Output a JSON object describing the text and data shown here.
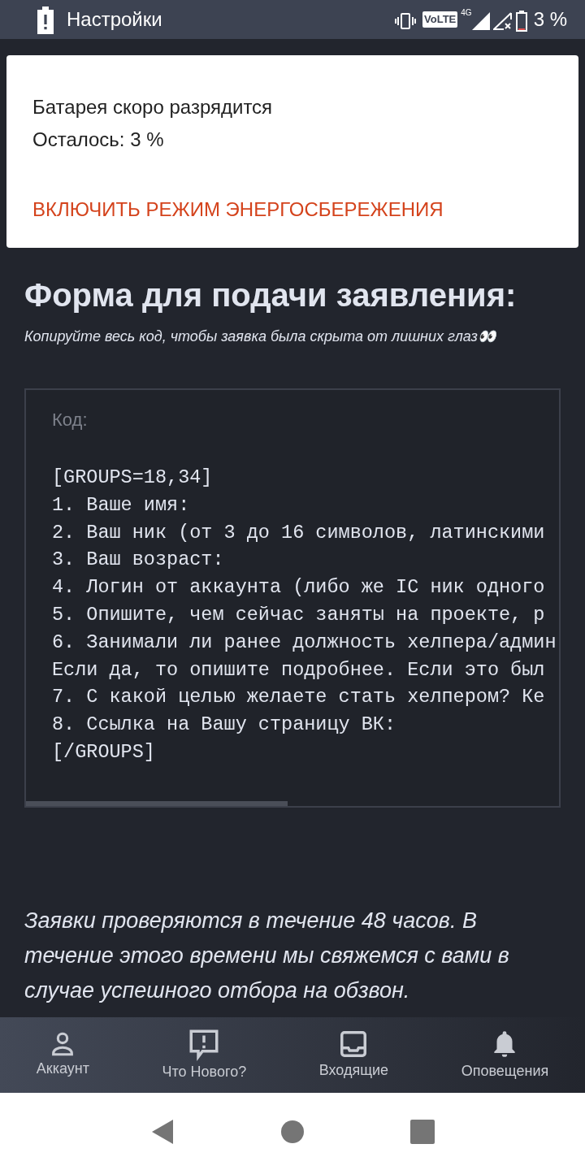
{
  "status_bar": {
    "app": "Настройки",
    "volte": "VoLTE",
    "network": "4G",
    "battery": "3 %"
  },
  "notification": {
    "title": "Батарея скоро разрядится",
    "text": "Осталось: 3 %",
    "action": "ВКЛЮЧИТЬ РЕЖИМ ЭНЕРГОСБЕРЕЖЕНИЯ"
  },
  "heading": "Форма для подачи заявления:",
  "subtitle": "Копируйте весь код, чтобы заявка была скрыта от лишних глаз👀",
  "code_block": {
    "label": "Код:",
    "lines": [
      "[GROUPS=18,34]",
      "1. Ваше имя:",
      "2. Ваш ник (от 3 до 16 символов, латинскими",
      "3. Ваш возраст:",
      "4. Логин от аккаунта (либо же IC ник одного",
      "5. Опишите, чем сейчас заняты на проекте, р",
      "6. Занимали ли ранее должность хелпера/админ",
      "Если да, то опишите подробнее. Если это был",
      "7. С какой целью желаете стать хелпером? Ке",
      "8. Ссылка на Вашу страницу ВК:",
      "[/GROUPS]"
    ]
  },
  "note": "Заявки проверяются в течение 48 часов. В течение этого времени мы свяжемся с вами в случае успешного отбора на обзвон.",
  "bottom_nav": [
    {
      "label": "Аккаунт",
      "kind": "person"
    },
    {
      "label": "Что Нового?",
      "kind": "alert"
    },
    {
      "label": "Входящие",
      "kind": "inbox"
    },
    {
      "label": "Оповещения",
      "kind": "bell"
    }
  ]
}
